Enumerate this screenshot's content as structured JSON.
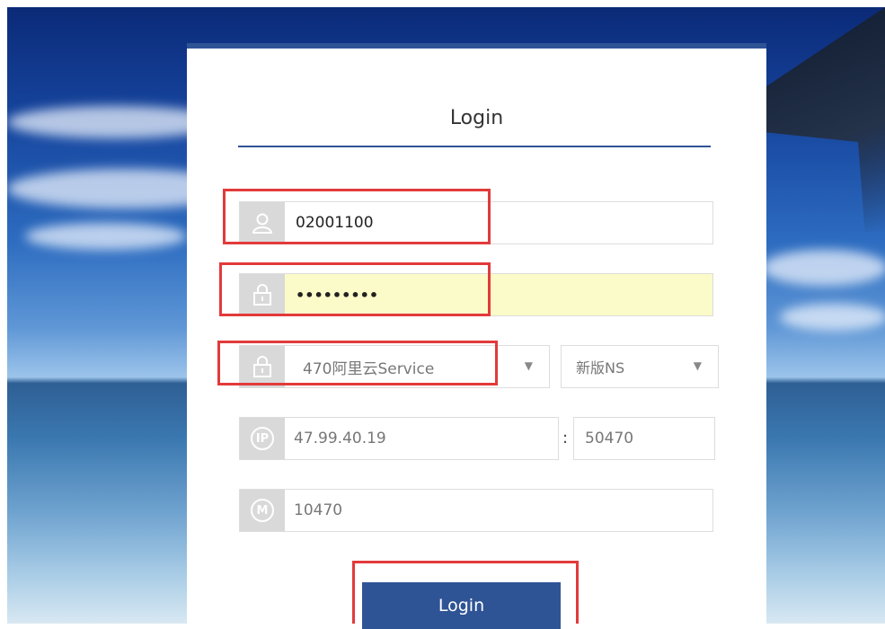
{
  "login": {
    "title": "Login",
    "username": "02001100",
    "password": "•••••••••",
    "server_select": "470阿里云Service",
    "version_select": "新版NS",
    "ip": "47.99.40.19",
    "port": "50470",
    "m_value": "10470",
    "button_label": "Login",
    "icons": {
      "user": "user-icon",
      "lock": "lock-icon",
      "ip": "ip-icon",
      "m": "m-icon"
    }
  },
  "colors": {
    "accent": "#2f5496",
    "highlight": "#e23a3a",
    "autofill": "#fbfbc9"
  }
}
